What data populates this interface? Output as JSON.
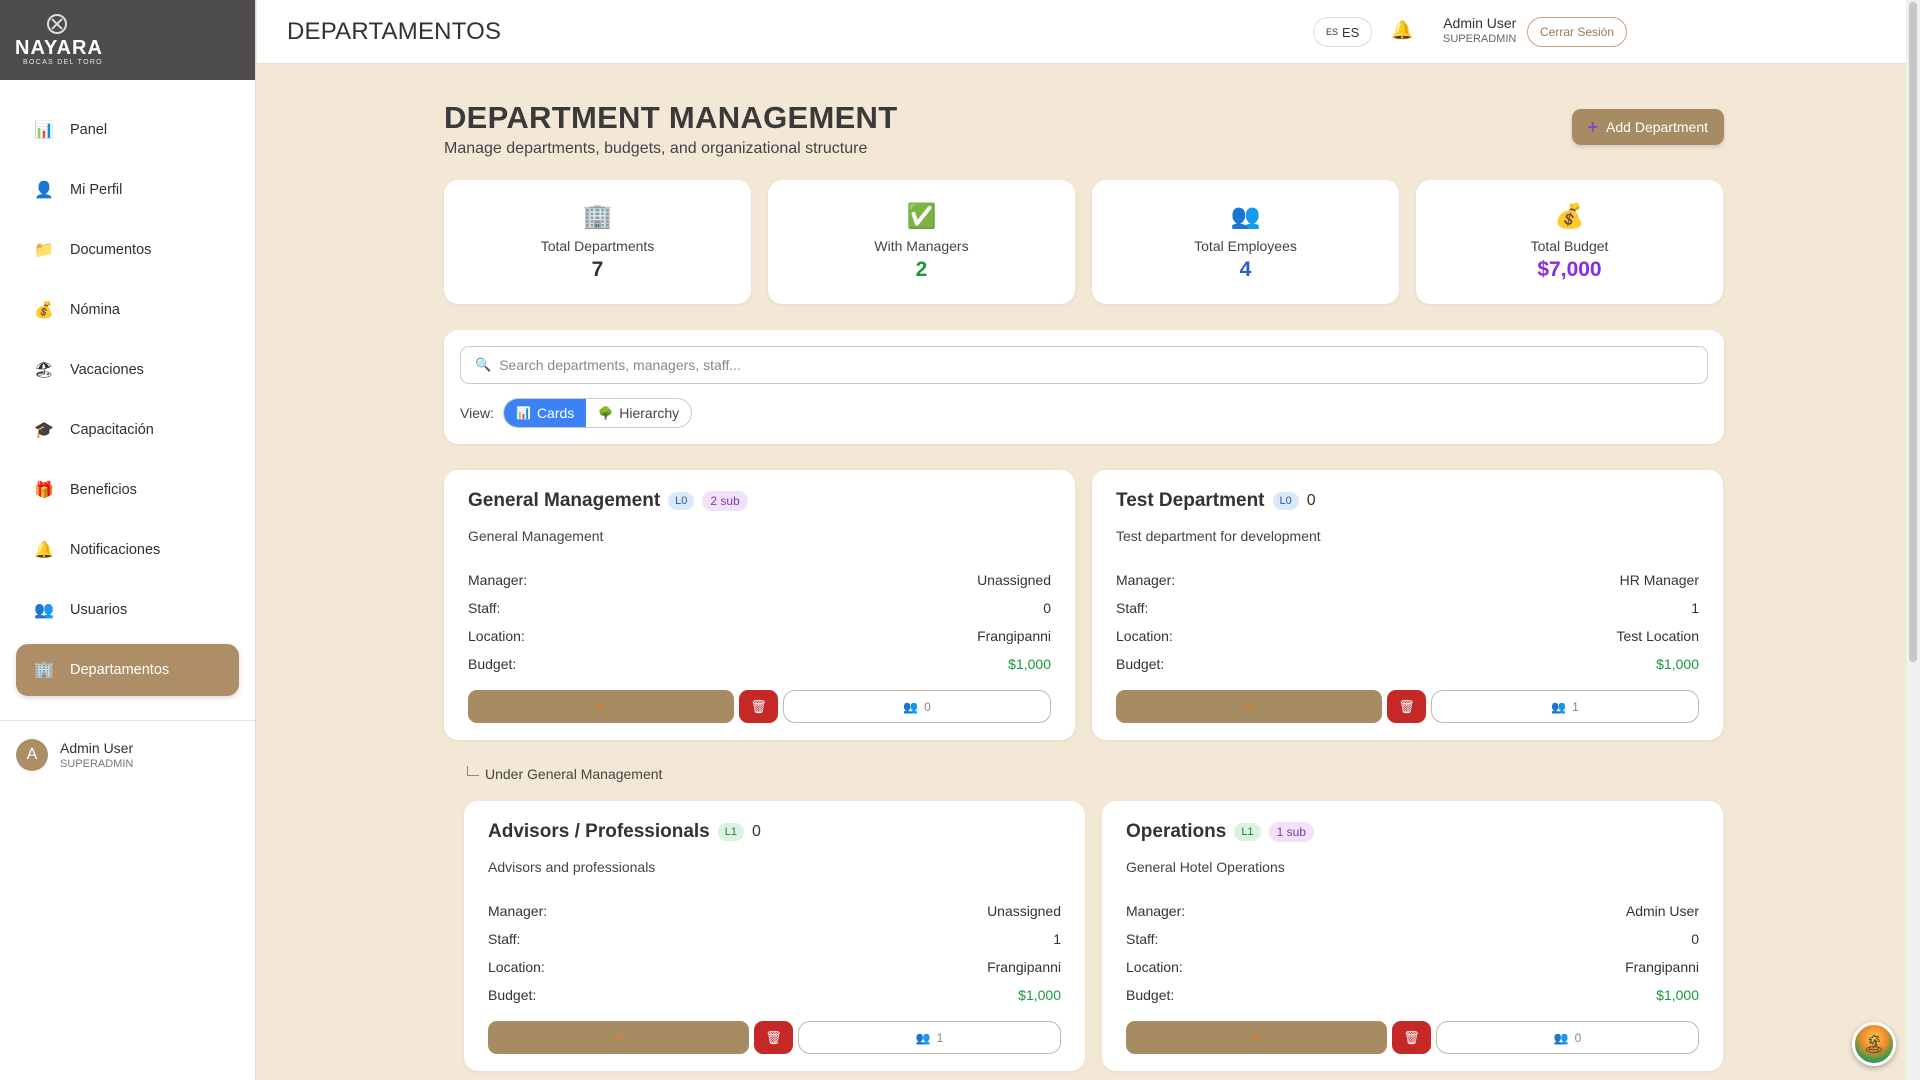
{
  "brand": {
    "name": "NAYARA",
    "subtitle": "BOCAS DEL TORO"
  },
  "sidebar": {
    "items": [
      {
        "label": "Panel",
        "icon": "chart-icon"
      },
      {
        "label": "Mi Perfil",
        "icon": "user-icon"
      },
      {
        "label": "Documentos",
        "icon": "folder-icon"
      },
      {
        "label": "Nómina",
        "icon": "money-bag-icon"
      },
      {
        "label": "Vacaciones",
        "icon": "beach-icon"
      },
      {
        "label": "Capacitación",
        "icon": "graduation-cap-icon"
      },
      {
        "label": "Beneficios",
        "icon": "gift-icon"
      },
      {
        "label": "Notificaciones",
        "icon": "bell-icon"
      },
      {
        "label": "Usuarios",
        "icon": "users-icon"
      },
      {
        "label": "Departamentos",
        "icon": "building-icon",
        "active": true
      }
    ],
    "user": {
      "initial": "A",
      "name": "Admin User",
      "role": "SUPERADMIN"
    }
  },
  "topbar": {
    "title": "DEPARTAMENTOS",
    "lang_flag": "ES",
    "lang_code": "ES",
    "user_name": "Admin User",
    "user_role": "SUPERADMIN",
    "logout": "Cerrar Sesión"
  },
  "page": {
    "title": "DEPARTMENT MANAGEMENT",
    "subtitle": "Manage departments, budgets, and organizational structure",
    "add_button": "Add Department"
  },
  "stats": [
    {
      "label": "Total Departments",
      "value": "7",
      "color": "#333333",
      "icon": "building-icon"
    },
    {
      "label": "With Managers",
      "value": "2",
      "color": "#1a9a3a",
      "icon": "checkmark-icon"
    },
    {
      "label": "Total Employees",
      "value": "4",
      "color": "#2c5ec0",
      "icon": "users-icon"
    },
    {
      "label": "Total Budget",
      "value": "$7,000",
      "color": "#8a2be2",
      "icon": "money-bag-icon"
    }
  ],
  "filter": {
    "search_placeholder": "Search departments, managers, staff...",
    "view_label": "View:",
    "view_options": [
      "Cards",
      "Hierarchy"
    ],
    "view_selected": "Cards"
  },
  "labels": {
    "manager": "Manager:",
    "staff": "Staff:",
    "location": "Location:",
    "budget": "Budget:"
  },
  "under_label": "Under General Management",
  "departments": [
    {
      "name": "General Management",
      "level": "L0",
      "sub": "2 sub",
      "desc": "General Management",
      "manager": "Unassigned",
      "staff": "0",
      "location": "Frangipanni",
      "budget": "$1,000",
      "staff_count": "0"
    },
    {
      "name": "Test Department",
      "level": "L0",
      "count": "0",
      "desc": "Test department for development",
      "manager": "HR Manager",
      "staff": "1",
      "location": "Test Location",
      "budget": "$1,000",
      "staff_count": "1"
    },
    {
      "name": "Advisors / Professionals",
      "level": "L1",
      "count": "0",
      "desc": "Advisors and professionals",
      "manager": "Unassigned",
      "staff": "1",
      "location": "Frangipanni",
      "budget": "$1,000",
      "staff_count": "1"
    },
    {
      "name": "Operations",
      "level": "L1",
      "sub": "1 sub",
      "desc": "General Hotel Operations",
      "manager": "Admin User",
      "staff": "0",
      "location": "Frangipanni",
      "budget": "$1,000",
      "staff_count": "0"
    }
  ]
}
